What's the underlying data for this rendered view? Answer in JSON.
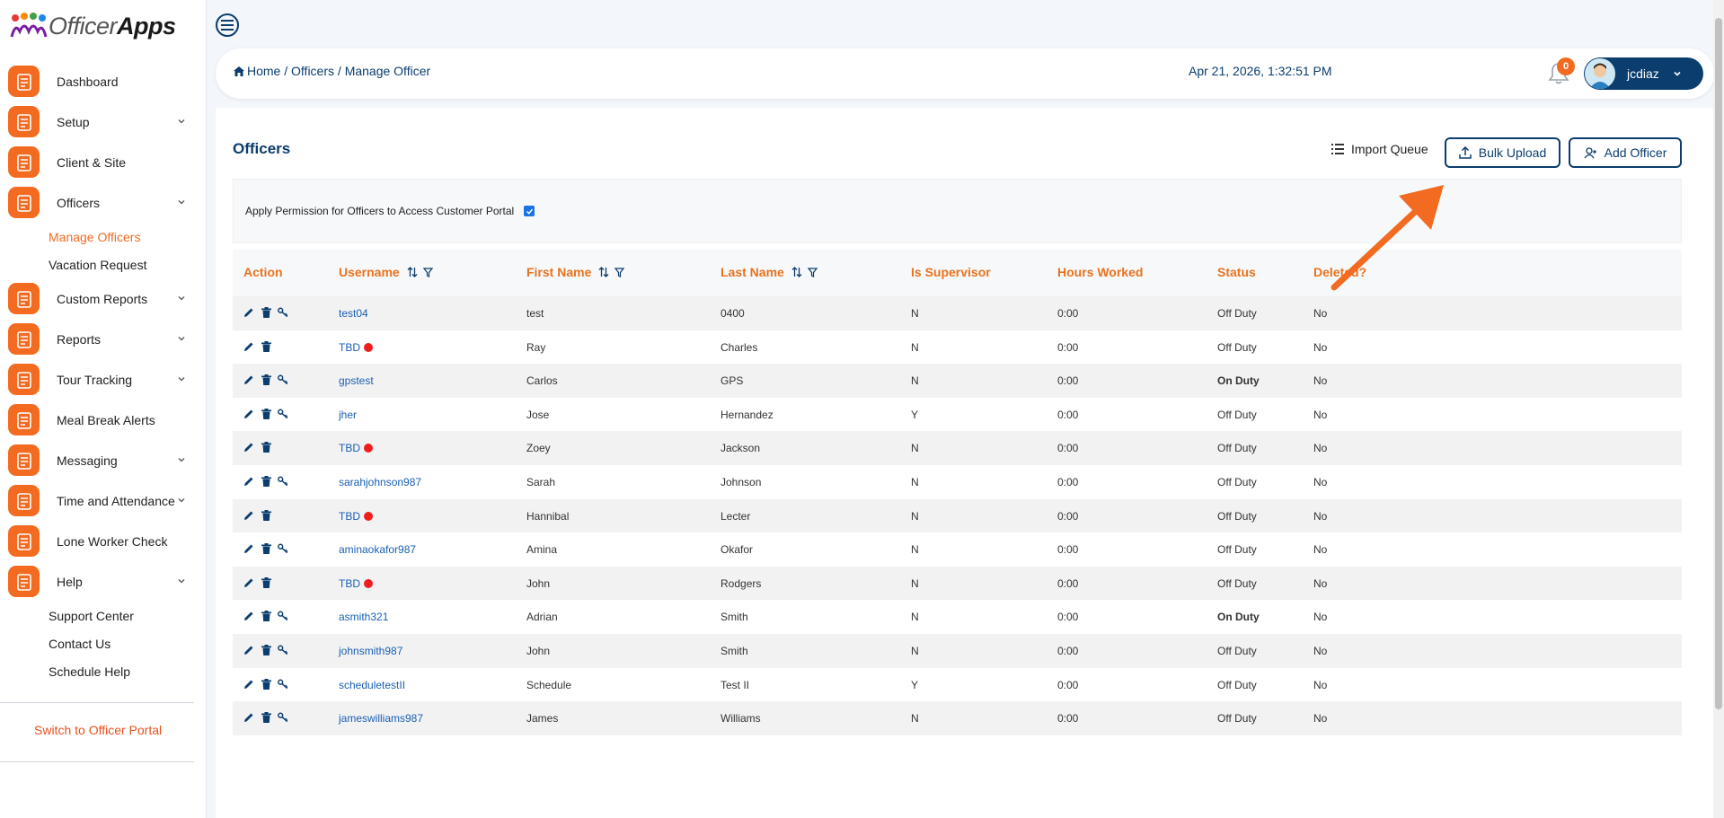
{
  "logo": {
    "text_a": "Officer",
    "text_b": "Apps"
  },
  "sidebar": {
    "items": [
      {
        "label": "Dashboard",
        "icon": "dashboard-icon",
        "chevron": false
      },
      {
        "label": "Setup",
        "icon": "setup-icon",
        "chevron": true
      },
      {
        "label": "Client & Site",
        "icon": "client-site-icon",
        "chevron": false
      },
      {
        "label": "Officers",
        "icon": "officer-icon",
        "chevron": true
      },
      {
        "label": "Custom Reports",
        "icon": "custom-reports-icon",
        "chevron": true
      },
      {
        "label": "Reports",
        "icon": "reports-icon",
        "chevron": true
      },
      {
        "label": "Tour Tracking",
        "icon": "tour-tracking-icon",
        "chevron": true
      },
      {
        "label": "Meal Break Alerts",
        "icon": "meal-break-icon",
        "chevron": false
      },
      {
        "label": "Messaging",
        "icon": "messaging-icon",
        "chevron": true
      },
      {
        "label": "Time and Attendance",
        "icon": "time-attendance-icon",
        "chevron": true
      },
      {
        "label": "Lone Worker Check",
        "icon": "lone-worker-icon",
        "chevron": false
      },
      {
        "label": "Help",
        "icon": "help-icon",
        "chevron": true
      }
    ],
    "officers_sub": [
      "Manage Officers",
      "Vacation Request"
    ],
    "help_sub": [
      "Support Center",
      "Contact Us",
      "Schedule Help"
    ],
    "switch_portal": "Switch to Officer Portal"
  },
  "header": {
    "breadcrumb": [
      "Home",
      "Officers",
      "Manage Officer"
    ],
    "datetime": "Apr 21, 2026, 1:32:51 PM",
    "notification_count": "0",
    "username": "jcdiaz"
  },
  "page": {
    "title": "Officers",
    "import_queue": "Import Queue",
    "bulk_upload": "Bulk Upload",
    "add_officer": "Add Officer",
    "permission_label": "Apply Permission for Officers to Access Customer Portal",
    "permission_checked": true
  },
  "table": {
    "columns": [
      "Action",
      "Username",
      "First Name",
      "Last Name",
      "Is Supervisor",
      "Hours Worked",
      "Status",
      "Deleted?"
    ],
    "rows": [
      {
        "username": "test04",
        "red_dot": false,
        "key_action": true,
        "first": "test",
        "last": "0400",
        "supervisor": "N",
        "hours": "0:00",
        "status": "Off Duty",
        "deleted": "No"
      },
      {
        "username": "TBD",
        "red_dot": true,
        "key_action": false,
        "first": "Ray",
        "last": "Charles",
        "supervisor": "N",
        "hours": "0:00",
        "status": "Off Duty",
        "deleted": "No"
      },
      {
        "username": "gpstest",
        "red_dot": false,
        "key_action": true,
        "first": "Carlos",
        "last": "GPS",
        "supervisor": "N",
        "hours": "0:00",
        "status": "On Duty",
        "deleted": "No"
      },
      {
        "username": "jher",
        "red_dot": false,
        "key_action": true,
        "first": "Jose",
        "last": "Hernandez",
        "supervisor": "Y",
        "hours": "0:00",
        "status": "Off Duty",
        "deleted": "No"
      },
      {
        "username": "TBD",
        "red_dot": true,
        "key_action": false,
        "first": "Zoey",
        "last": "Jackson",
        "supervisor": "N",
        "hours": "0:00",
        "status": "Off Duty",
        "deleted": "No"
      },
      {
        "username": "sarahjohnson987",
        "red_dot": false,
        "key_action": true,
        "first": "Sarah",
        "last": "Johnson",
        "supervisor": "N",
        "hours": "0:00",
        "status": "Off Duty",
        "deleted": "No"
      },
      {
        "username": "TBD",
        "red_dot": true,
        "key_action": false,
        "first": "Hannibal",
        "last": "Lecter",
        "supervisor": "N",
        "hours": "0:00",
        "status": "Off Duty",
        "deleted": "No"
      },
      {
        "username": "aminaokafor987",
        "red_dot": false,
        "key_action": true,
        "first": "Amina",
        "last": "Okafor",
        "supervisor": "N",
        "hours": "0:00",
        "status": "Off Duty",
        "deleted": "No"
      },
      {
        "username": "TBD",
        "red_dot": true,
        "key_action": false,
        "first": "John",
        "last": "Rodgers",
        "supervisor": "N",
        "hours": "0:00",
        "status": "Off Duty",
        "deleted": "No"
      },
      {
        "username": "asmith321",
        "red_dot": false,
        "key_action": true,
        "first": "Adrian",
        "last": "Smith",
        "supervisor": "N",
        "hours": "0:00",
        "status": "On Duty",
        "deleted": "No"
      },
      {
        "username": "johnsmith987",
        "red_dot": false,
        "key_action": true,
        "first": "John",
        "last": "Smith",
        "supervisor": "N",
        "hours": "0:00",
        "status": "Off Duty",
        "deleted": "No"
      },
      {
        "username": "scheduletestII",
        "red_dot": false,
        "key_action": true,
        "first": "Schedule",
        "last": "Test II",
        "supervisor": "Y",
        "hours": "0:00",
        "status": "Off Duty",
        "deleted": "No"
      },
      {
        "username": "jameswilliams987",
        "red_dot": false,
        "key_action": true,
        "first": "James",
        "last": "Williams",
        "supervisor": "N",
        "hours": "0:00",
        "status": "Off Duty",
        "deleted": "No"
      }
    ]
  },
  "colors": {
    "accent": "#f26b21",
    "navy": "#0b3d6e",
    "link": "#1a5fb4",
    "column_header": "#e8731e"
  }
}
